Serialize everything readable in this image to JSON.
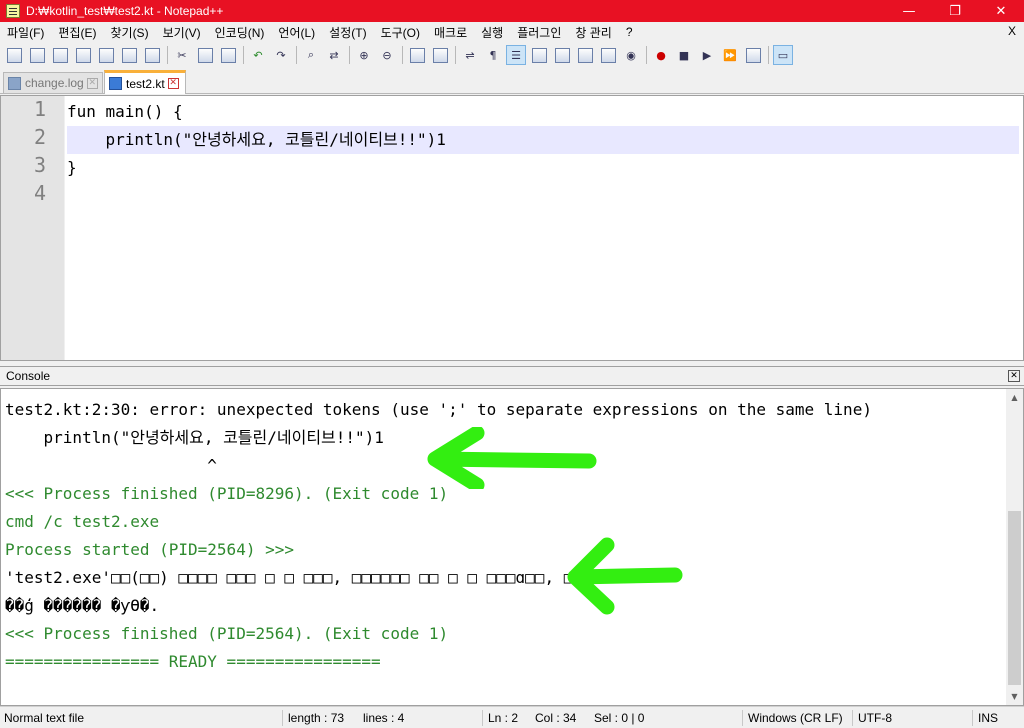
{
  "window": {
    "title": "D:₩kotlin_test₩test2.kt - Notepad++",
    "minimize": "—",
    "maximize": "❐",
    "close": "✕",
    "title_color": "#e81123"
  },
  "menu": {
    "items": [
      "파일(F)",
      "편집(E)",
      "찾기(S)",
      "보기(V)",
      "인코딩(N)",
      "언어(L)",
      "설정(T)",
      "도구(O)",
      "매크로",
      "실행",
      "플러그인",
      "창 관리",
      "?"
    ],
    "close": "X"
  },
  "tabs": [
    {
      "label": "change.log",
      "active": false
    },
    {
      "label": "test2.kt",
      "active": true
    }
  ],
  "editor": {
    "line_numbers": [
      "1",
      "2",
      "3",
      "4"
    ],
    "lines": [
      "fun main() {",
      "    println(\"안녕하세요, 코틀린/네이티브!!\")1",
      "}",
      ""
    ],
    "current_line": 2
  },
  "console": {
    "title": "Console",
    "close": "✕",
    "lines": [
      {
        "text": "test2.kt:2:30: error: unexpected tokens (use ';' to separate expressions on the same line)",
        "color": "black"
      },
      {
        "text": "    println(\"안녕하세요, 코틀린/네이티브!!\")1",
        "color": "black"
      },
      {
        "text": "                     ^",
        "color": "black"
      },
      {
        "text": "<<< Process finished (PID=8296). (Exit code 1)",
        "color": "green"
      },
      {
        "text": "cmd /c test2.exe",
        "color": "green"
      },
      {
        "text": "Process started (PID=2564) >>>",
        "color": "green"
      },
      {
        "text": "'test2.exe'□□(□□) □□□□ □□□ □ □ □□□, □□□□□□ □□ □ □ □□□ɑ□□, □□□",
        "color": "black"
      },
      {
        "text": "��ģ ������ �ƴϴ�.",
        "color": "black"
      },
      {
        "text": "<<< Process finished (PID=2564). (Exit code 1)",
        "color": "green"
      },
      {
        "text": "================ READY ================",
        "color": "green"
      }
    ],
    "annotation_color": "#33ee11"
  },
  "status": {
    "type": "Normal text file",
    "length": "length : 73",
    "lines": "lines : 4",
    "ln": "Ln : 2",
    "col": "Col : 34",
    "sel": "Sel : 0 | 0",
    "eol": "Windows (CR LF)",
    "encoding": "UTF-8",
    "mode": "INS"
  }
}
